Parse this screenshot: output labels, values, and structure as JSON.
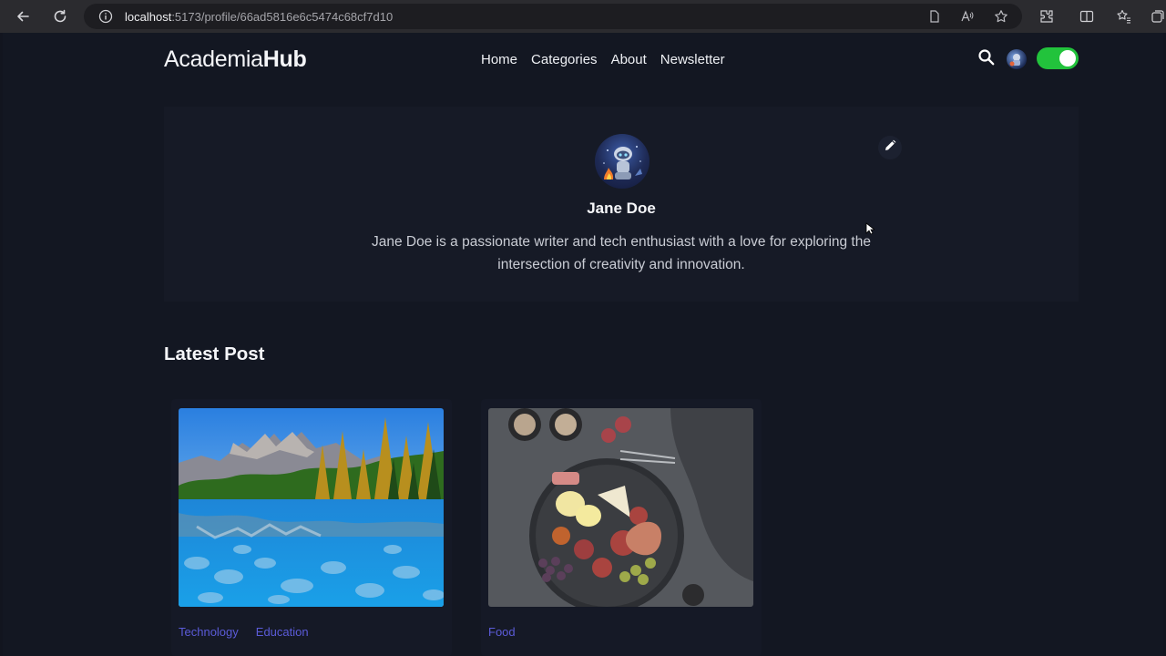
{
  "browser": {
    "url_host": "localhost",
    "url_path": ":5173/profile/66ad5816e6c5474c68cf7d10"
  },
  "header": {
    "logo_light": "Academia",
    "logo_bold": "Hub",
    "nav": [
      "Home",
      "Categories",
      "About",
      "Newsletter"
    ],
    "theme_toggle_on": true
  },
  "profile": {
    "name": "Jane Doe",
    "bio": "Jane Doe is a passionate writer and tech enthusiast with a love for exploring the intersection of creativity and innovation."
  },
  "latest": {
    "title": "Latest Post",
    "posts": [
      {
        "image": "mountain-lake-image",
        "tags": [
          "Technology",
          "Education"
        ]
      },
      {
        "image": "food-platter-image",
        "tags": [
          "Food"
        ]
      }
    ]
  },
  "colors": {
    "page_bg": "#131722",
    "card_bg": "#161a26",
    "toggle": "#22c33c",
    "tag": "#5b5bd8"
  }
}
